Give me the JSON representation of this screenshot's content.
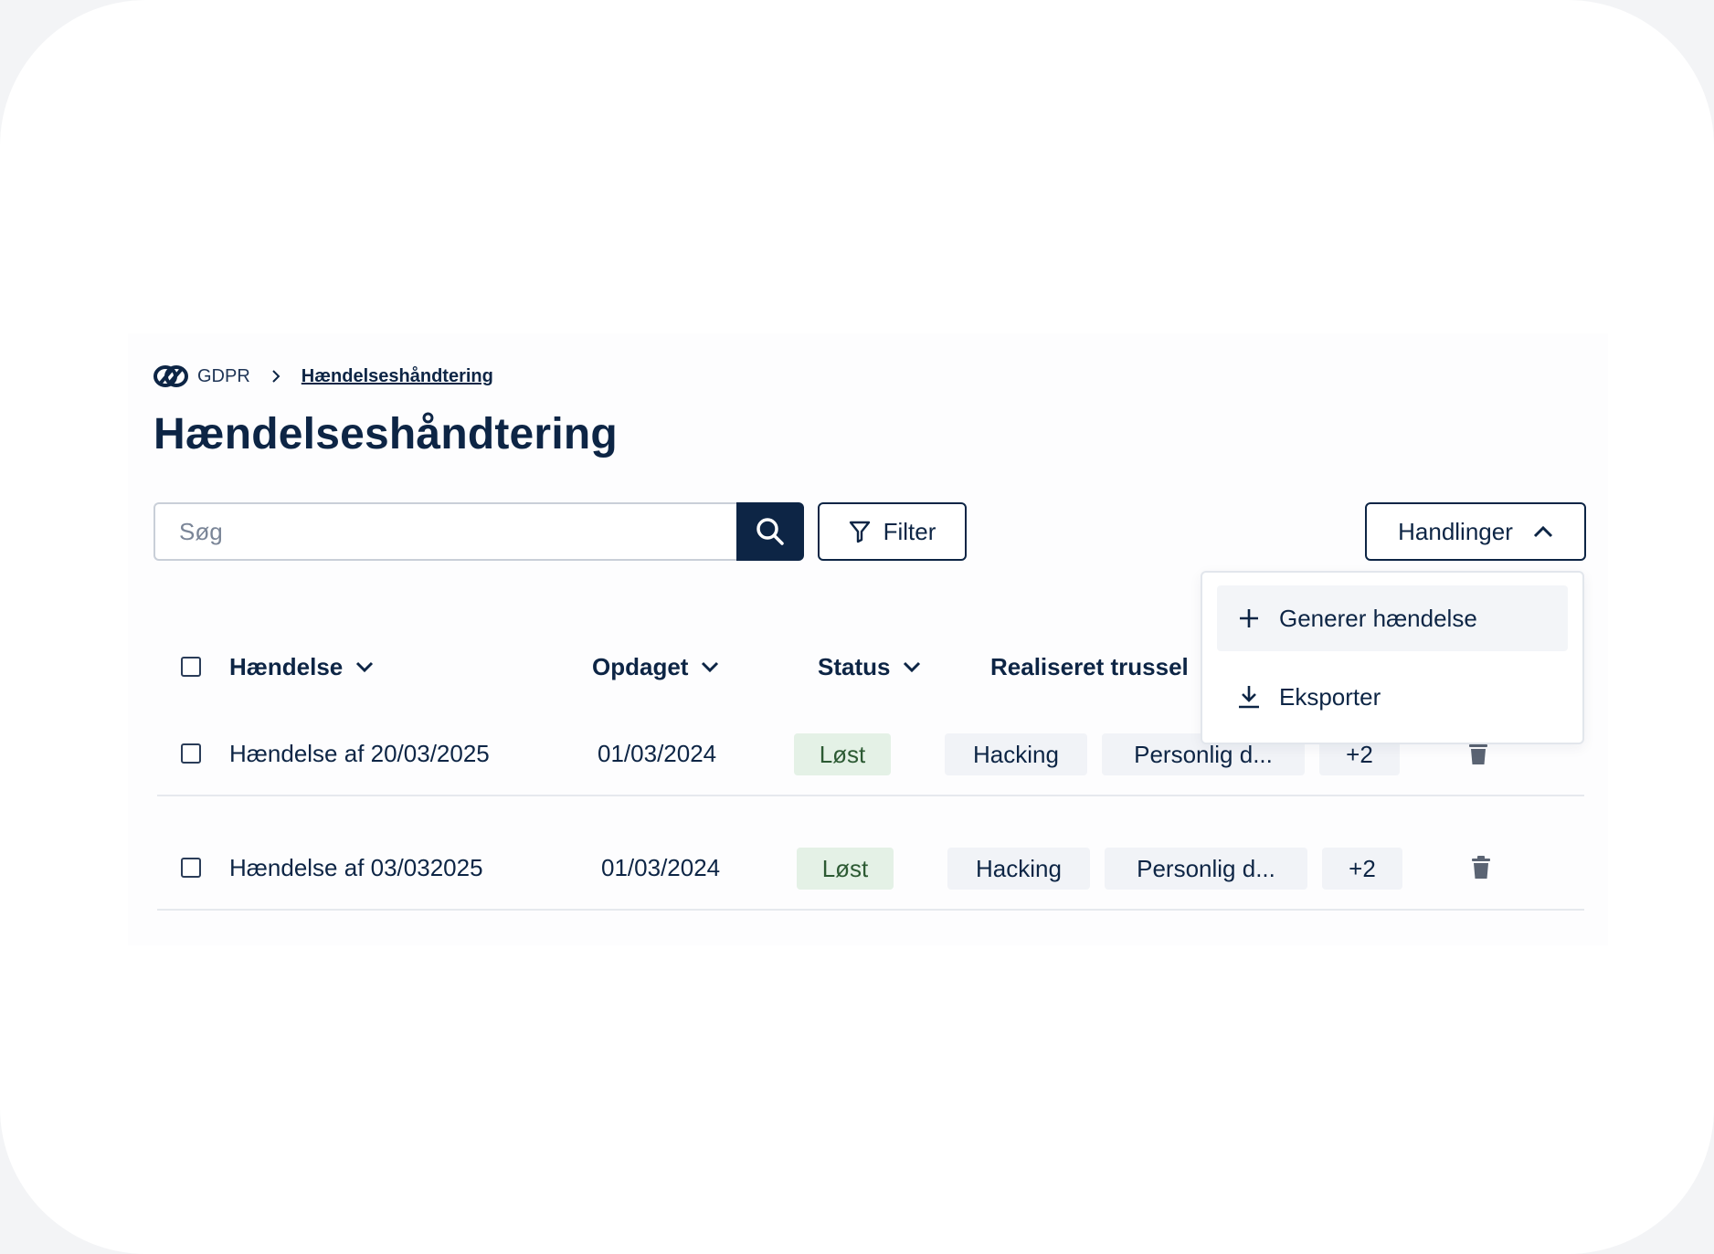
{
  "breadcrumb": {
    "root": "GDPR",
    "current": "Hændelseshåndtering"
  },
  "page": {
    "title": "Hændelseshåndtering"
  },
  "toolbar": {
    "search_placeholder": "Søg",
    "search_value": "",
    "filter_label": "Filter",
    "actions_label": "Handlinger"
  },
  "actions_menu": {
    "items": [
      {
        "label": "Generer hændelse",
        "icon": "plus-icon"
      },
      {
        "label": "Eksporter",
        "icon": "download-icon"
      }
    ]
  },
  "table": {
    "columns": [
      {
        "label": "Hændelse",
        "sortable": true
      },
      {
        "label": "Opdaget",
        "sortable": true
      },
      {
        "label": "Status",
        "sortable": true
      },
      {
        "label": "Realiseret trussel",
        "sortable": true
      }
    ],
    "rows": [
      {
        "name": "Hændelse af 20/03/2025",
        "detected": "01/03/2024",
        "status": "Løst",
        "threats": [
          "Hacking",
          "Personlig d..."
        ],
        "more": "+2"
      },
      {
        "name": "Hændelse af 03/032025",
        "detected": "01/03/2024",
        "status": "Løst",
        "threats": [
          "Hacking",
          "Personlig d..."
        ],
        "more": "+2"
      }
    ]
  },
  "colors": {
    "primary": "#0d2545",
    "status_resolved_bg": "#e4f1e6",
    "status_resolved_text": "#2c5a33",
    "chip_bg": "#f1f3f7"
  }
}
